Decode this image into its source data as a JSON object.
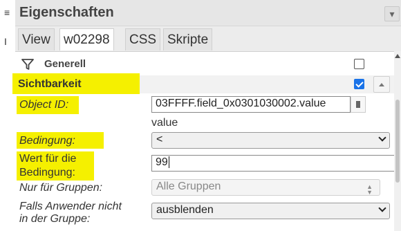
{
  "panel": {
    "title": "Eigenschaften"
  },
  "tabs": [
    {
      "label": "View"
    },
    {
      "label": "w02298"
    },
    {
      "label": "CSS"
    },
    {
      "label": "Skripte"
    }
  ],
  "group": {
    "label": "Generell",
    "checked": false
  },
  "section": {
    "label": "Sichtbarkeit",
    "checked": true
  },
  "fields": {
    "object_id": {
      "label": "Object ID:",
      "value": "03FFFF.field_0x0301030002.value"
    },
    "value_hint": "value",
    "condition": {
      "label": "Bedingung:",
      "value": "<"
    },
    "condition_value": {
      "label_line1": "Wert für die",
      "label_line2": "Bedingung:",
      "value": "99"
    },
    "only_groups": {
      "label": "Nur für Gruppen:",
      "value": "Alle Gruppen"
    },
    "if_not_in_group": {
      "label_line1": "Falls Anwender nicht",
      "label_line2": "in der Gruppe:",
      "value": "ausblenden"
    }
  },
  "colors": {
    "highlight": "#f5f000",
    "checkbox_checked": "#1a73e8"
  }
}
